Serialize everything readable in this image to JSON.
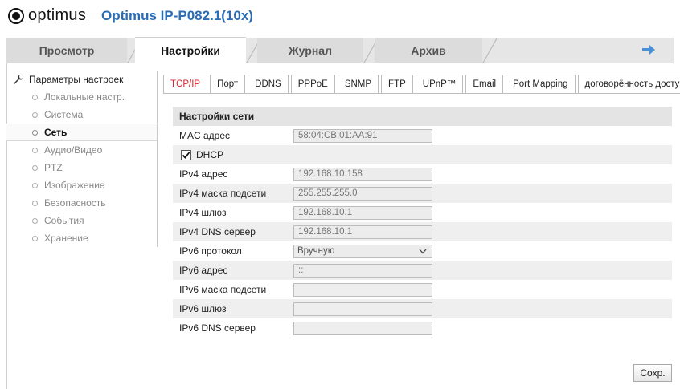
{
  "header": {
    "logo_text": "optimus",
    "model": "Optimus IP-P082.1(10x)"
  },
  "top_tabs": [
    {
      "label": "Просмотр"
    },
    {
      "label": "Настройки"
    },
    {
      "label": "Журнал"
    },
    {
      "label": "Архив"
    }
  ],
  "sidebar": {
    "title": "Параметры настроек",
    "items": [
      {
        "label": "Локальные настр."
      },
      {
        "label": "Система"
      },
      {
        "label": "Сеть"
      },
      {
        "label": "Аудио/Видео"
      },
      {
        "label": "PTZ"
      },
      {
        "label": "Изображение"
      },
      {
        "label": "Безопасность"
      },
      {
        "label": "События"
      },
      {
        "label": "Хранение"
      }
    ]
  },
  "sub_tabs": [
    {
      "label": "TCP/IP"
    },
    {
      "label": "Порт"
    },
    {
      "label": "DDNS"
    },
    {
      "label": "PPPoE"
    },
    {
      "label": "SNMP"
    },
    {
      "label": "FTP"
    },
    {
      "label": "UPnP™"
    },
    {
      "label": "Email"
    },
    {
      "label": "Port Mapping"
    },
    {
      "label": "договорённость доступ"
    }
  ],
  "form": {
    "section_title": "Настройки сети",
    "mac_label": "MAC адрес",
    "mac_value": "58:04:CB:01:AA:91",
    "dhcp_label": "DHCP",
    "dhcp_checked": true,
    "ipv4_address_label": "IPv4 адрес",
    "ipv4_address_value": "192.168.10.158",
    "ipv4_mask_label": "IPv4 маска подсети",
    "ipv4_mask_value": "255.255.255.0",
    "ipv4_gateway_label": "IPv4 шлюз",
    "ipv4_gateway_value": "192.168.10.1",
    "ipv4_dns_label": "IPv4 DNS сервер",
    "ipv4_dns_value": "192.168.10.1",
    "ipv6_mode_label": "IPv6 протокол",
    "ipv6_mode_value": "Вручную",
    "ipv6_address_label": "IPv6 адрес",
    "ipv6_address_value": "::",
    "ipv6_mask_label": "IPv6 маска подсети",
    "ipv6_mask_value": "",
    "ipv6_gateway_label": "IPv6 шлюз",
    "ipv6_gateway_value": "",
    "ipv6_dns_label": "IPv6 DNS сервер",
    "ipv6_dns_value": ""
  },
  "save_label": "Сохр.",
  "colors": {
    "brand_blue": "#2a6db5",
    "active_subtab": "#d9232d"
  }
}
